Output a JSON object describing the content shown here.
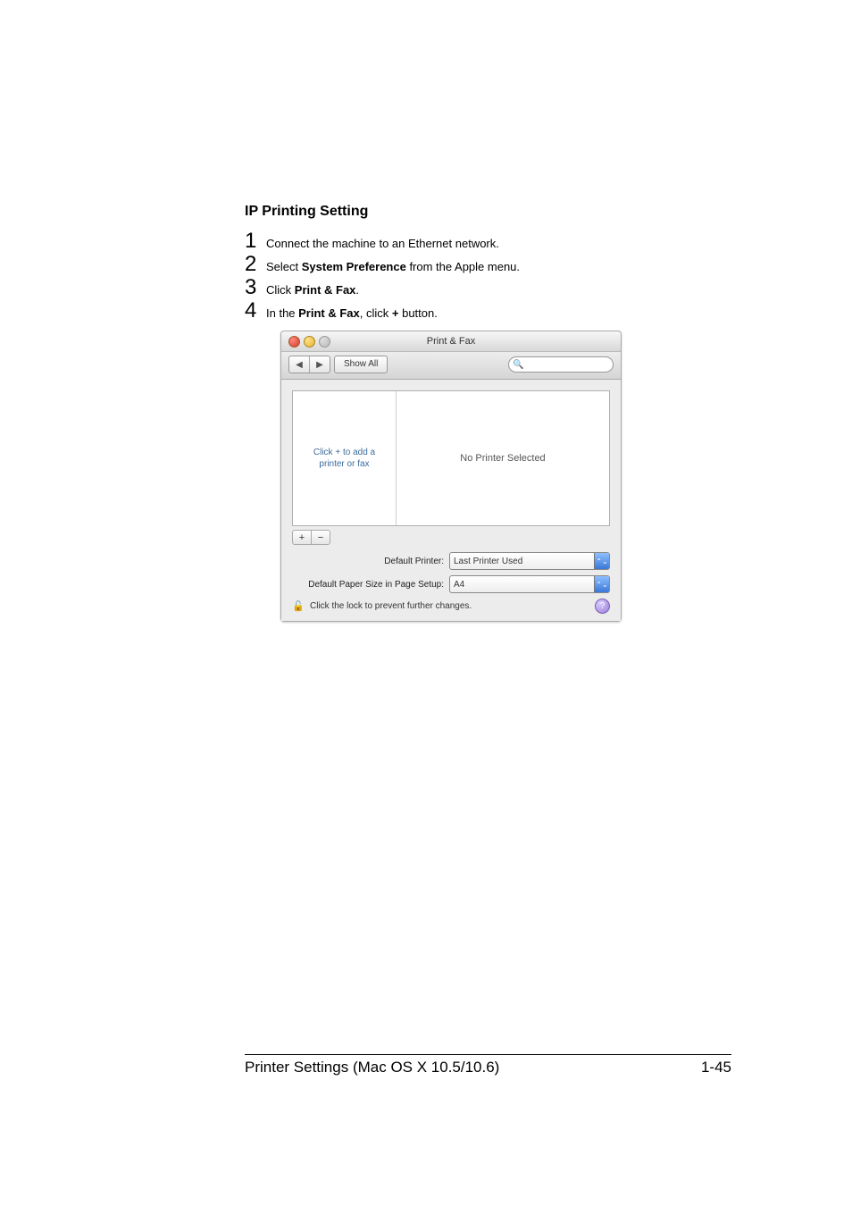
{
  "heading": "IP Printing Setting",
  "steps": {
    "s1_pre": "Connect the machine to an Ethernet network.",
    "s2_pre": "Select ",
    "s2_bold": "System Preference",
    "s2_post": " from the Apple menu.",
    "s3_pre": "Click ",
    "s3_bold": "Print & Fax",
    "s3_post": ".",
    "s4_pre": "In the ",
    "s4_bold1": "Print & Fax",
    "s4_mid": ", click ",
    "s4_bold2": "+",
    "s4_post": " button."
  },
  "mac": {
    "title": "Print & Fax",
    "showall": "Show All",
    "list_hint_l1": "Click + to add a",
    "list_hint_l2": "printer or fax",
    "right_msg": "No Printer Selected",
    "plus": "+",
    "minus": "−",
    "default_printer_label": "Default Printer:",
    "default_printer_value": "Last Printer Used",
    "paper_label": "Default Paper Size in Page Setup:",
    "paper_value": "A4",
    "lock_text": "Click the lock to prevent further changes.",
    "back": "◀",
    "fwd": "▶",
    "updown": "▲▼",
    "help": "?"
  },
  "footer": {
    "left": "Printer Settings (Mac OS X 10.5/10.6)",
    "right": "1-45"
  }
}
